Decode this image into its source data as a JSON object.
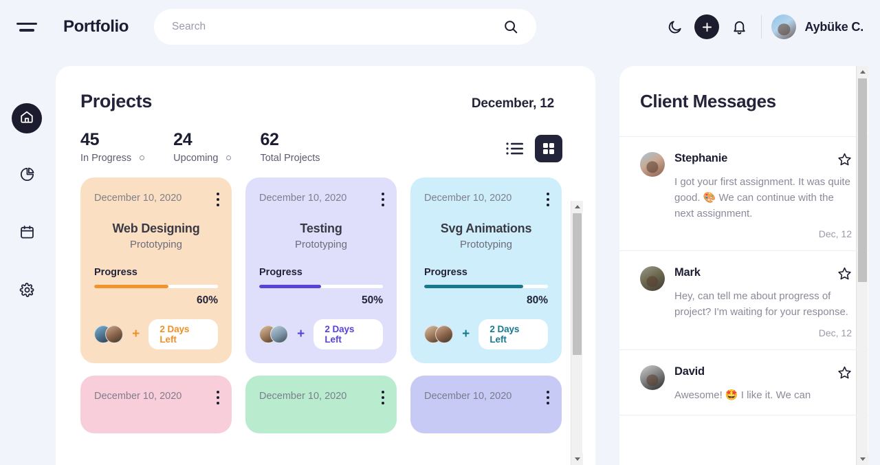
{
  "header": {
    "menu_icon": "hamburger-icon",
    "brand": "Portfolio",
    "search": {
      "value": "",
      "placeholder": "Search",
      "icon": "search-icon"
    },
    "moon_icon": "moon-icon",
    "add_icon": "plus-icon",
    "bell_icon": "bell-icon",
    "user_name": "Aybüke C."
  },
  "sidebar": {
    "items": [
      {
        "name": "home",
        "icon": "home-icon",
        "active": true
      },
      {
        "name": "analytics",
        "icon": "pie-chart-icon",
        "active": false
      },
      {
        "name": "calendar",
        "icon": "calendar-icon",
        "active": false
      },
      {
        "name": "settings",
        "icon": "gear-icon",
        "active": false
      }
    ]
  },
  "projects": {
    "title": "Projects",
    "date": "December, 12",
    "stats": [
      {
        "value": "45",
        "label": "In Progress",
        "has_dot": true
      },
      {
        "value": "24",
        "label": "Upcoming",
        "has_dot": true
      },
      {
        "value": "62",
        "label": "Total Projects",
        "has_dot": false
      }
    ],
    "view_list_icon": "list-view-icon",
    "view_grid_icon": "grid-view-icon",
    "active_view": "grid",
    "progress_label": "Progress",
    "cards": [
      {
        "date": "December 10, 2020",
        "title": "Web Designing",
        "subtitle": "Prototyping",
        "progress_label": "Progress",
        "progress": 60,
        "progress_text": "60%",
        "days_left": "2 Days Left",
        "theme": "c-orange",
        "accent": "#f0942b",
        "show_details": true
      },
      {
        "date": "December 10, 2020",
        "title": "Testing",
        "subtitle": "Prototyping",
        "progress_label": "Progress",
        "progress": 50,
        "progress_text": "50%",
        "days_left": "2 Days Left",
        "theme": "c-purple",
        "accent": "#5743d6",
        "show_details": true
      },
      {
        "date": "December 10, 2020",
        "title": "Svg Animations",
        "subtitle": "Prototyping",
        "progress_label": "Progress",
        "progress": 80,
        "progress_text": "80%",
        "days_left": "2 Days Left",
        "theme": "c-cyan",
        "accent": "#17788e",
        "show_details": true
      },
      {
        "date": "December 10, 2020",
        "title": "",
        "subtitle": "",
        "progress_label": "",
        "progress": 0,
        "progress_text": "",
        "days_left": "",
        "theme": "c-pink",
        "accent": "#e86a92",
        "show_details": false
      },
      {
        "date": "December 10, 2020",
        "title": "",
        "subtitle": "",
        "progress_label": "",
        "progress": 0,
        "progress_text": "",
        "days_left": "",
        "theme": "c-mint",
        "accent": "#2fae6b",
        "show_details": false
      },
      {
        "date": "December 10, 2020",
        "title": "",
        "subtitle": "",
        "progress_label": "",
        "progress": 0,
        "progress_text": "",
        "days_left": "",
        "theme": "c-peri",
        "accent": "#5b63d3",
        "show_details": false
      }
    ]
  },
  "messages": {
    "title": "Client Messages",
    "items": [
      {
        "name": "Stephanie",
        "text": "I got your first assignment. It was quite good. 🎨 We can continue with the next assignment.",
        "date": "Dec, 12",
        "avatar_class": "a-steph",
        "starred": false
      },
      {
        "name": "Mark",
        "text": "Hey, can tell me about progress of project? I'm waiting for your response.",
        "date": "Dec, 12",
        "avatar_class": "a-mark",
        "starred": false
      },
      {
        "name": "David",
        "text": "Awesome! 🤩 I like it. We can",
        "date": "",
        "avatar_class": "a-david",
        "starred": false
      }
    ]
  },
  "colors": {
    "page_bg": "#f2f4fb",
    "panel_bg": "#ffffff",
    "ink": "#23233a",
    "muted": "#8a8a99"
  }
}
